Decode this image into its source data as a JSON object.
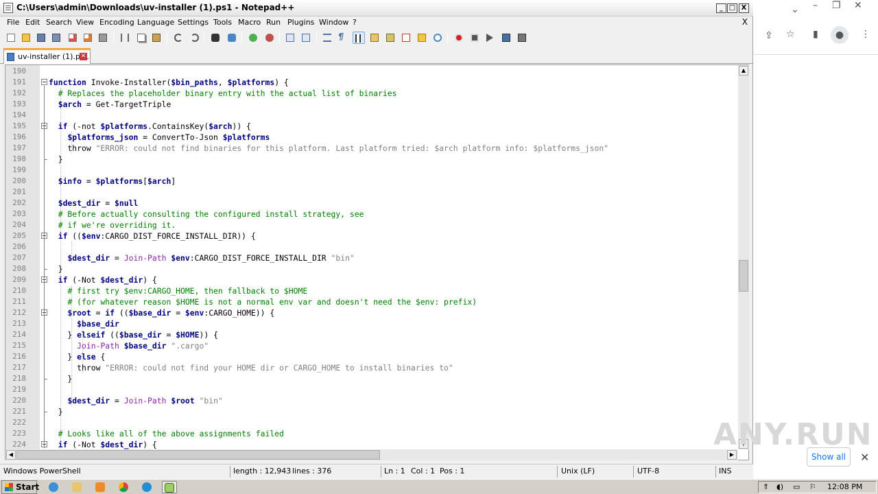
{
  "window": {
    "title": "C:\\Users\\admin\\Downloads\\uv-installer (1).ps1 - Notepad++",
    "minimize": "_",
    "maximize": "□",
    "close": "X"
  },
  "menu": [
    "File",
    "Edit",
    "Search",
    "View",
    "Encoding",
    "Language",
    "Settings",
    "Tools",
    "Macro",
    "Run",
    "Plugins",
    "Window",
    "?"
  ],
  "menu_close": "X",
  "tab": {
    "label": "uv-installer (1).ps1",
    "close": "✕"
  },
  "editor": {
    "lines": [
      {
        "n": "190",
        "t": ""
      },
      {
        "n": "191",
        "t": "<span class='k'>function</span> Invoke-Installer(<span class='v'>$bin_paths</span>, <span class='v'>$platforms</span>) {"
      },
      {
        "n": "192",
        "t": "  <span class='c'># Replaces the placeholder binary entry with the actual list of binaries</span>"
      },
      {
        "n": "193",
        "t": "  <span class='v'>$arch</span> = Get-TargetTriple"
      },
      {
        "n": "194",
        "t": ""
      },
      {
        "n": "195",
        "t": "  <span class='k'>if</span> (-not <span class='v'>$platforms</span>.ContainsKey(<span class='v'>$arch</span>)) {"
      },
      {
        "n": "196",
        "t": "    <span class='v'>$platforms_json</span> = ConvertTo-Json <span class='v'>$platforms</span>"
      },
      {
        "n": "197",
        "t": "    throw <span class='s'>\"ERROR: could not find binaries for this platform. Last platform tried: $arch platform info: $platforms_json\"</span>"
      },
      {
        "n": "198",
        "t": "  }"
      },
      {
        "n": "199",
        "t": ""
      },
      {
        "n": "200",
        "t": "  <span class='v'>$info</span> = <span class='v'>$platforms</span>[<span class='v'>$arch</span>]"
      },
      {
        "n": "201",
        "t": ""
      },
      {
        "n": "202",
        "t": "  <span class='v'>$dest_dir</span> = <span class='v'>$null</span>"
      },
      {
        "n": "203",
        "t": "  <span class='c'># Before actually consulting the configured install strategy, see</span>"
      },
      {
        "n": "204",
        "t": "  <span class='c'># if we're overriding it.</span>"
      },
      {
        "n": "205",
        "t": "  <span class='k'>if</span> ((<span class='v'>$env</span>:CARGO_DIST_FORCE_INSTALL_DIR)) {"
      },
      {
        "n": "206",
        "t": ""
      },
      {
        "n": "207",
        "t": "    <span class='v'>$dest_dir</span> = <span class='p'>Join-Path</span> <span class='v'>$env</span>:CARGO_DIST_FORCE_INSTALL_DIR <span class='s'>\"bin\"</span>"
      },
      {
        "n": "208",
        "t": "  }"
      },
      {
        "n": "209",
        "t": "  <span class='k'>if</span> (-Not <span class='v'>$dest_dir</span>) {"
      },
      {
        "n": "210",
        "t": "    <span class='c'># first try $env:CARGO_HOME, then fallback to $HOME</span>"
      },
      {
        "n": "211",
        "t": "    <span class='c'># (for whatever reason $HOME is not a normal env var and doesn't need the $env: prefix)</span>"
      },
      {
        "n": "212",
        "t": "    <span class='v'>$root</span> = <span class='k'>if</span> ((<span class='v'>$base_dir</span> = <span class='v'>$env</span>:CARGO_HOME)) {"
      },
      {
        "n": "213",
        "t": "      <span class='v'>$base_dir</span>"
      },
      {
        "n": "214",
        "t": "    } <span class='k'>elseif</span> ((<span class='v'>$base_dir</span> = <span class='v'>$HOME</span>)) {"
      },
      {
        "n": "215",
        "t": "      <span class='p'>Join-Path</span> <span class='v'>$base_dir</span> <span class='s'>\".cargo\"</span>"
      },
      {
        "n": "216",
        "t": "    } <span class='k'>else</span> {"
      },
      {
        "n": "217",
        "t": "      throw <span class='s'>\"ERROR: could not find your HOME dir or CARGO_HOME to install binaries to\"</span>"
      },
      {
        "n": "218",
        "t": "    }"
      },
      {
        "n": "219",
        "t": ""
      },
      {
        "n": "220",
        "t": "    <span class='v'>$dest_dir</span> = <span class='p'>Join-Path</span> <span class='v'>$root</span> <span class='s'>\"bin\"</span>"
      },
      {
        "n": "221",
        "t": "  }"
      },
      {
        "n": "222",
        "t": ""
      },
      {
        "n": "223",
        "t": "  <span class='c'># Looks like all of the above assignments failed</span>"
      },
      {
        "n": "224",
        "t": "  <span class='k'>if</span> (-Not <span class='v'>$dest_dir</span>) {"
      }
    ]
  },
  "status": {
    "language": "Windows PowerShell",
    "length": "length : 12,943",
    "lines": "lines : 376",
    "ln": "Ln : 1",
    "col": "Col : 1",
    "pos": "Pos : 1",
    "eol": "Unix (LF)",
    "encoding": "UTF-8",
    "mode": "INS"
  },
  "browser": {
    "show_all": "Show all",
    "watermark": "ANY.RUN"
  },
  "taskbar": {
    "start": "Start",
    "clock": "12:08 PM"
  },
  "colors": {
    "keyword": "#00008b",
    "variable": "#000080",
    "comment": "#008000",
    "string": "#808080",
    "cmdlet": "#8e24aa",
    "tab_accent": "#f9a53a"
  }
}
